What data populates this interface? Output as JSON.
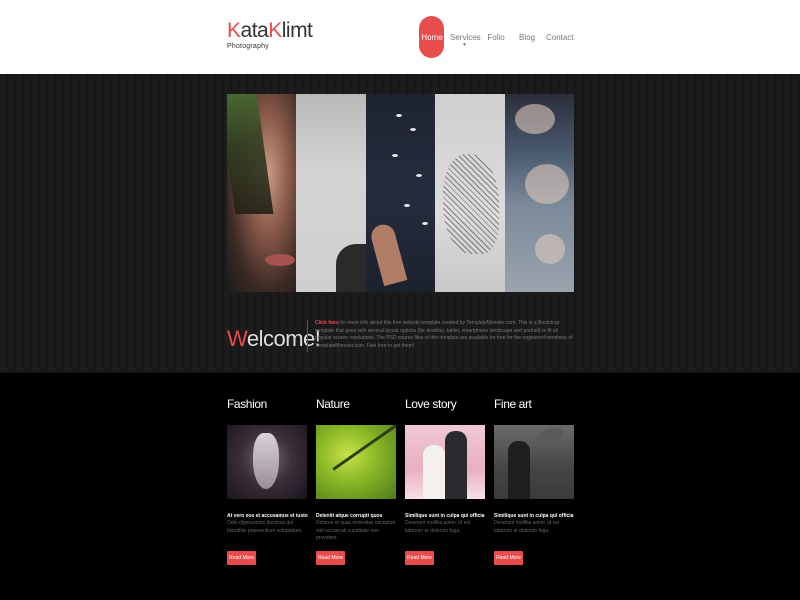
{
  "brand": {
    "first": "Kata",
    "second": "Klimt",
    "tagline": "Photography",
    "accent": "#e84c4c"
  },
  "nav": {
    "home": "Home",
    "services": "Services",
    "folio": "Folio",
    "blog": "Blog",
    "contact": "Contact"
  },
  "welcome": {
    "title_first": "W",
    "title_rest": "elcome!",
    "link": "Click here",
    "text": " for more info about this free website template created by TemplateMonster.com. This is a Bootstrap template that goes with several layout options (for desktop, tablet, smartphone landscape and portrait) to fit all popular screen resolutions. The PSD source files of this template are available for free for the registered members of TemplateMonster.com. Feel free to get them!"
  },
  "columns": [
    {
      "title": "Fashion",
      "subtitle": "At vero eos et accusamus et iusto",
      "text": "Odio dignissimos ducimus qui blanditiis praesentium voluptatum.",
      "button": "Read More"
    },
    {
      "title": "Nature",
      "subtitle": "Deleniti atque corrupti quos",
      "text": "Dolores et quas molestias excepturi sint occaecati cupiditate non provident.",
      "button": "Read More"
    },
    {
      "title": "Love story",
      "subtitle": "Similique sunt in culpa qui officia",
      "text": "Deserunt mollitia animi, id est laborum et dolorum fuga.",
      "button": "Read More"
    },
    {
      "title": "Fine art",
      "subtitle": "Similique sunt in culpa qui officia",
      "text": "Deserunt mollitia animi, id est laborum et dolorum fuga.",
      "button": "Read More"
    }
  ]
}
